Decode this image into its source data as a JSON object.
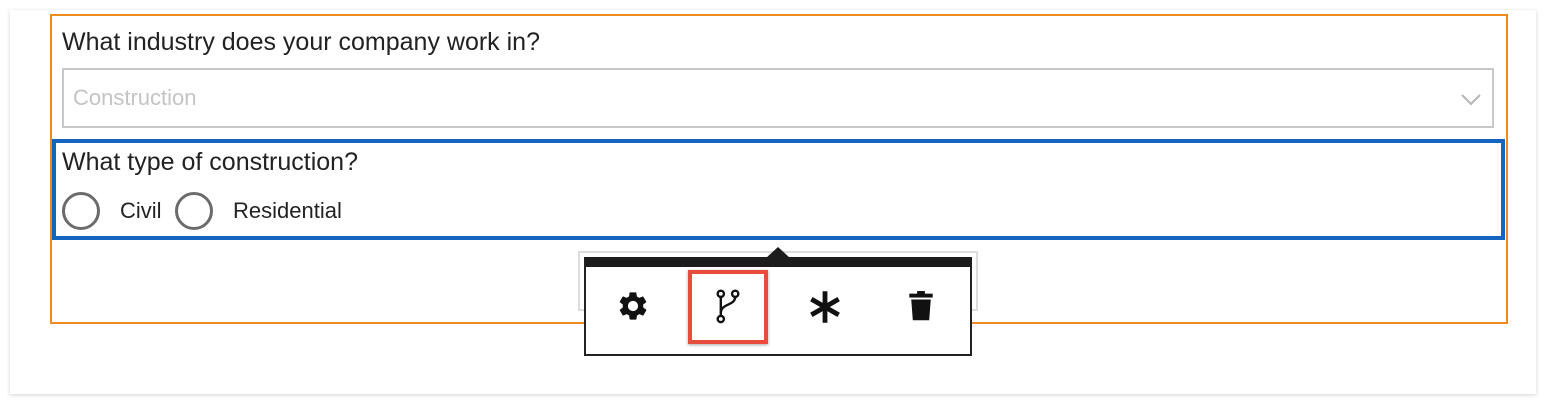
{
  "form": {
    "question1": {
      "label": "What industry does your company work in?",
      "select": {
        "value": "Construction",
        "icon": "chevron-down-icon"
      }
    },
    "question2": {
      "label": "What type of construction?",
      "options": [
        {
          "label": "Civil",
          "selected": false
        },
        {
          "label": "Residential",
          "selected": false
        }
      ]
    }
  },
  "toolbar": {
    "buttons": [
      {
        "name": "settings",
        "icon": "gear-icon"
      },
      {
        "name": "branching",
        "icon": "branch-icon",
        "highlighted": true
      },
      {
        "name": "required",
        "icon": "asterisk-icon"
      },
      {
        "name": "delete",
        "icon": "trash-icon"
      }
    ]
  },
  "colors": {
    "page_section_border": "#ef8b1d",
    "selected_question_border": "#1565c0",
    "highlight_annotation": "#e74c3c",
    "toolbar_bar": "#1c1c1c"
  }
}
